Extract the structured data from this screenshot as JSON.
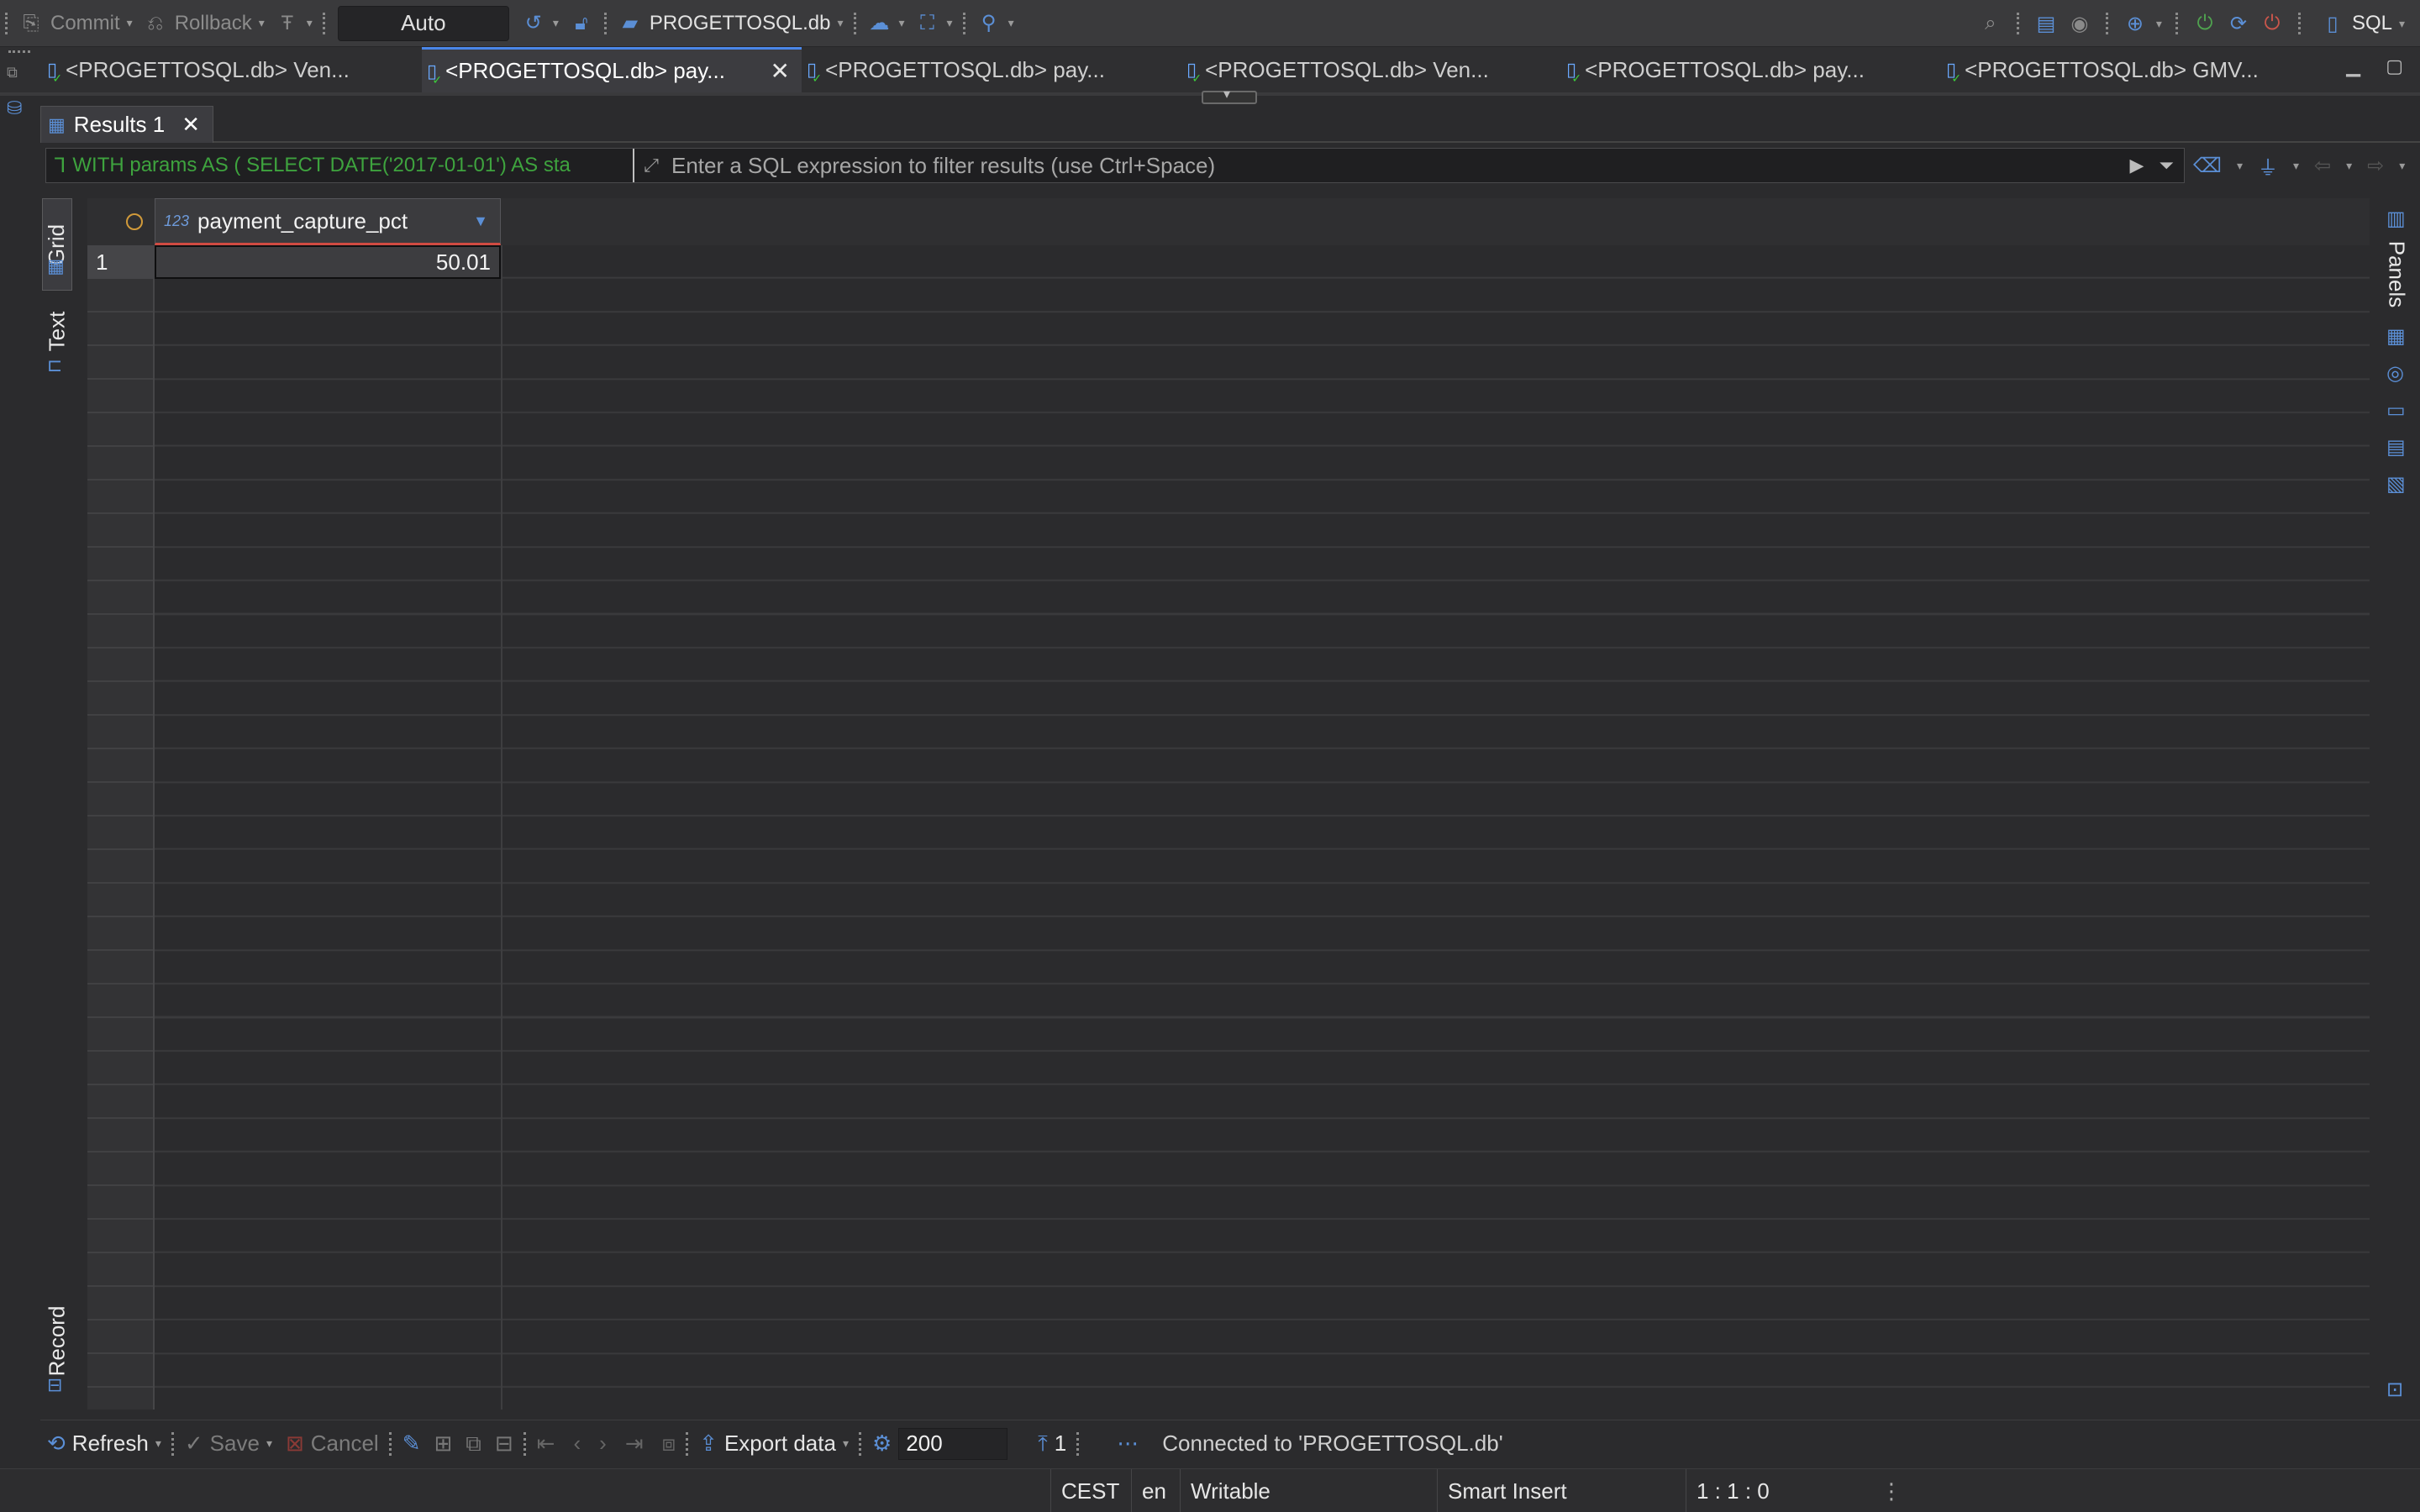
{
  "toolbar": {
    "commit_label": "Commit",
    "rollback_label": "Rollback",
    "tx_mode": "Auto",
    "datasource": "PROGETTOSQL.db",
    "sql_label": "SQL"
  },
  "editor_tabs": [
    {
      "label": "<PROGETTOSQL.db> Ven...",
      "active": false
    },
    {
      "label": "<PROGETTOSQL.db> pay...",
      "active": true
    },
    {
      "label": "<PROGETTOSQL.db> pay...",
      "active": false
    },
    {
      "label": "<PROGETTOSQL.db> Ven...",
      "active": false
    },
    {
      "label": "<PROGETTOSQL.db> pay...",
      "active": false
    },
    {
      "label": "<PROGETTOSQL.db> GMV...",
      "active": false
    }
  ],
  "results": {
    "tab_label": "Results 1",
    "query_preview": "WITH params AS ( SELECT DATE('2017-01-01') AS sta",
    "filter_placeholder": "Enter a SQL expression to filter results (use Ctrl+Space)",
    "view_modes": {
      "grid": "Grid",
      "text": "Text",
      "record": "Record"
    },
    "panels_label": "Panels",
    "columns": [
      {
        "name": "payment_capture_pct",
        "type_icon": "123"
      }
    ],
    "rows": [
      {
        "num": "1",
        "cells": [
          "50.01"
        ]
      }
    ]
  },
  "bottom_bar": {
    "refresh": "Refresh",
    "save": "Save",
    "cancel": "Cancel",
    "export": "Export data",
    "fetch_size": "200",
    "row_count": "1",
    "status_message": "Connected to 'PROGETTOSQL.db'"
  },
  "status_bar": {
    "timezone": "CEST",
    "locale": "en",
    "mode": "Writable",
    "insert_mode": "Smart Insert",
    "position": "1 : 1 : 0"
  },
  "colors": {
    "accent": "#4a86e8",
    "query_text": "#3ea33e",
    "header_underline": "#d04b42"
  }
}
